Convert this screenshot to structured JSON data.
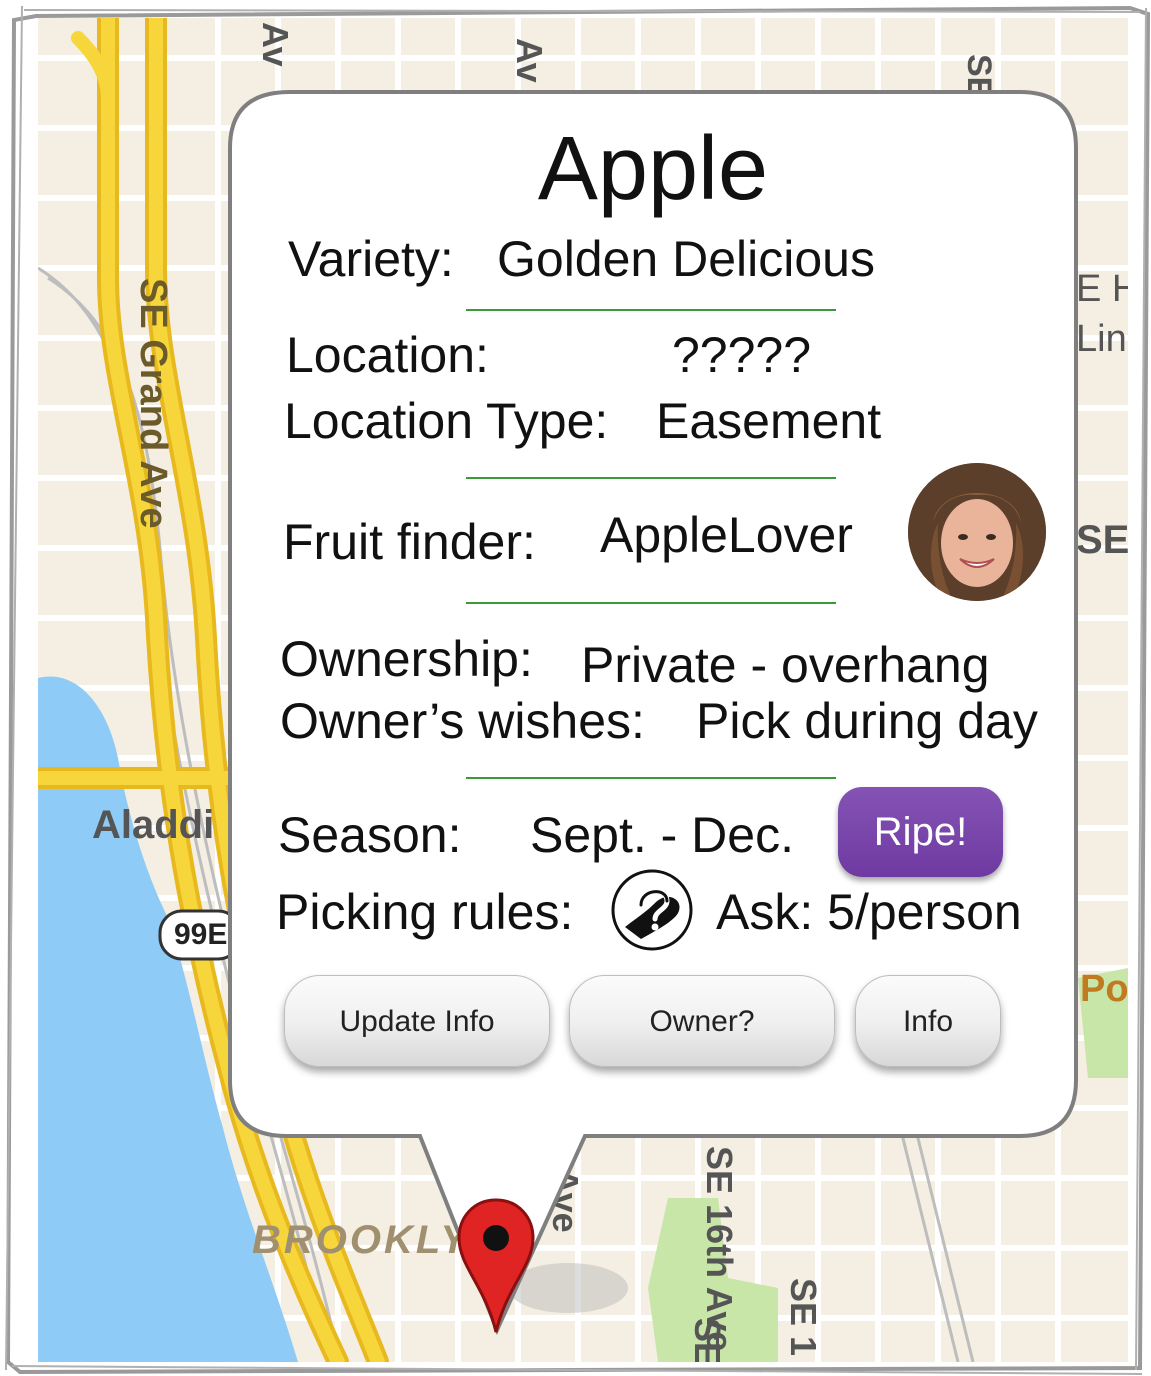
{
  "fruit": {
    "title": "Apple",
    "variety_label": "Variety:",
    "variety_value": "Golden Delicious",
    "location_label": "Location:",
    "location_value": "?????",
    "location_type_label": "Location Type:",
    "location_type_value": "Easement",
    "finder_label": "Fruit finder:",
    "finder_value": "AppleLover",
    "ownership_label": "Ownership:",
    "ownership_value": "Private - overhang",
    "owner_wishes_label": "Owner’s wishes:",
    "owner_wishes_value": "Pick during day",
    "season_label": "Season:",
    "season_value": "Sept. - Dec.",
    "ripe_badge": "Ripe!",
    "picking_rules_label": "Picking rules:",
    "picking_rules_value": "Ask: 5/person"
  },
  "buttons": {
    "update": "Update Info",
    "owner": "Owner?",
    "info": "Info"
  },
  "map_labels": {
    "grand_ave": "SE Grand Ave",
    "aladdin": "Aladdi",
    "highway": "99E",
    "brooklyn": "BROOKLY",
    "sixteenth": "SE 16th Ave",
    "ave1": "Av",
    "ave2": "Av",
    "ave3": "Ave",
    "se_top": "SE",
    "se_right": "SE",
    "se_bottom1": "SE 1",
    "se_bottom2": "SE",
    "eh": "E H",
    "lin": "Lin",
    "po": "Po"
  },
  "colors": {
    "ripe": "#7a45ad",
    "divider": "#3a9a3a",
    "pin": "#e02424",
    "freeway": "#f6d63a",
    "water": "#8ecbf6",
    "park": "#c8e6a8"
  },
  "icons": {
    "picking_rules": "hand-question-icon",
    "pin": "map-pin-icon"
  }
}
